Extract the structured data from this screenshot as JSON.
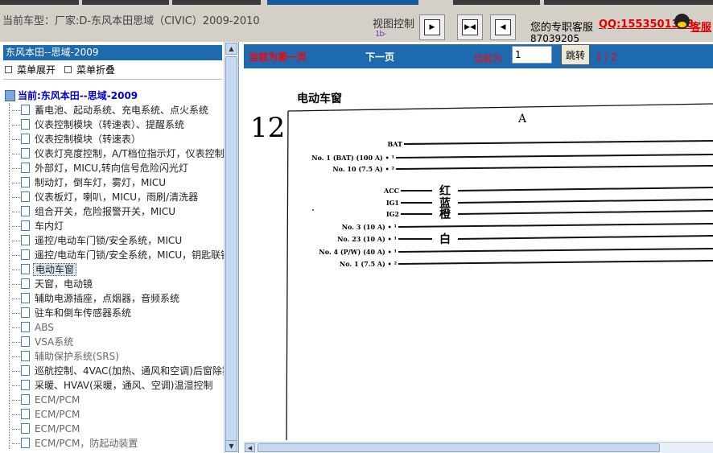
{
  "header": {
    "car_info": "当前车型：厂家:D-东风本田思域（CIVIC）2009-2010",
    "view_control_label": "视图控制",
    "view_mini_label": "1b-",
    "view_buttons": [
      {
        "icon": "arrow-right-icon",
        "glyph": "▶"
      },
      {
        "icon": "fit-width-icon",
        "glyph": "▶◀"
      },
      {
        "icon": "arrow-left-icon",
        "glyph": "◀"
      }
    ],
    "service_label": "您的专职客服",
    "qq_text": "QQ:1553501388",
    "phone": "87039205",
    "service_link": "客服"
  },
  "sidebar": {
    "title": "东风本田--思域-2009",
    "expand_label": "菜单展开",
    "collapse_label": "菜单折叠",
    "current": "当前:东风本田--思域-2009",
    "selected_index": 12,
    "items": [
      {
        "label": "蓄电池、起动系统、充电系统、点火系统"
      },
      {
        "label": "仪表控制模块（转速表）、提醒系统"
      },
      {
        "label": "仪表控制模块（转速表）"
      },
      {
        "label": "仪表灯亮度控制，A/T档位指示灯，仪表控制"
      },
      {
        "label": "外部灯，MICU,转向信号危险闪光灯"
      },
      {
        "label": "制动灯，倒车灯，雾灯，MICU"
      },
      {
        "label": "仪表板灯，喇叭，MICU，雨刷/清洗器"
      },
      {
        "label": "组合开关，危险报警开关，MICU"
      },
      {
        "label": "车内灯"
      },
      {
        "label": "遥控/电动车门锁/安全系统，MICU"
      },
      {
        "label": "遥控/电动车门锁/安全系统，MICU，钥匙联锁"
      },
      {
        "label": "电动车窗"
      },
      {
        "label": "电动车窗"
      },
      {
        "label": "天窗，电动镜"
      },
      {
        "label": "辅助电源插座，点烟器，音频系统"
      },
      {
        "label": "驻车和倒车传感器系统"
      },
      {
        "label": "ABS"
      },
      {
        "label": "VSA系统"
      },
      {
        "label": "辅助保护系统(SRS)"
      },
      {
        "label": "巡航控制、4VAC(加热、通风和空调)后窗除雾"
      },
      {
        "label": "采暖、HVAV(采暖，通风、空调)温湿控制"
      },
      {
        "label": "ECM/PCM"
      },
      {
        "label": "ECM/PCM"
      },
      {
        "label": "ECM/PCM"
      },
      {
        "label": "ECM/PCM，防起动装置"
      }
    ]
  },
  "viewer": {
    "prev_label": "当前为第一页",
    "next_label": "下一页",
    "current_label": "当前为",
    "page_value": "1",
    "jump_label": "跳转",
    "page_count": "1 / 2"
  },
  "diagram": {
    "page_title": "电动车窗",
    "section_number": "12",
    "column_label": "A",
    "wires": [
      {
        "label": "BAT",
        "color": ""
      },
      {
        "label": "No. 1 (BAT) (100 A) • ¹",
        "color": ""
      },
      {
        "label": "No. 10 (7.5 A) • ²",
        "color": ""
      },
      {
        "label": "ACC",
        "color": "红"
      },
      {
        "label": "IG1",
        "color": "蓝"
      },
      {
        "label": "IG2",
        "color": "橙"
      },
      {
        "label": "No. 3 (10 A) • ¹",
        "color": ""
      },
      {
        "label": "No. 23 (10 A) • ¹",
        "color": "白"
      },
      {
        "label": "No. 4 (P/W) (40 A) • ¹",
        "color": ""
      },
      {
        "label": "No. 1 (7.5 A) • ²",
        "color": ""
      }
    ]
  },
  "colors": {
    "panel_blue": "#1e6ab0",
    "toolbar_gray": "#d4d0c8",
    "accent_red": "#ff0000"
  }
}
